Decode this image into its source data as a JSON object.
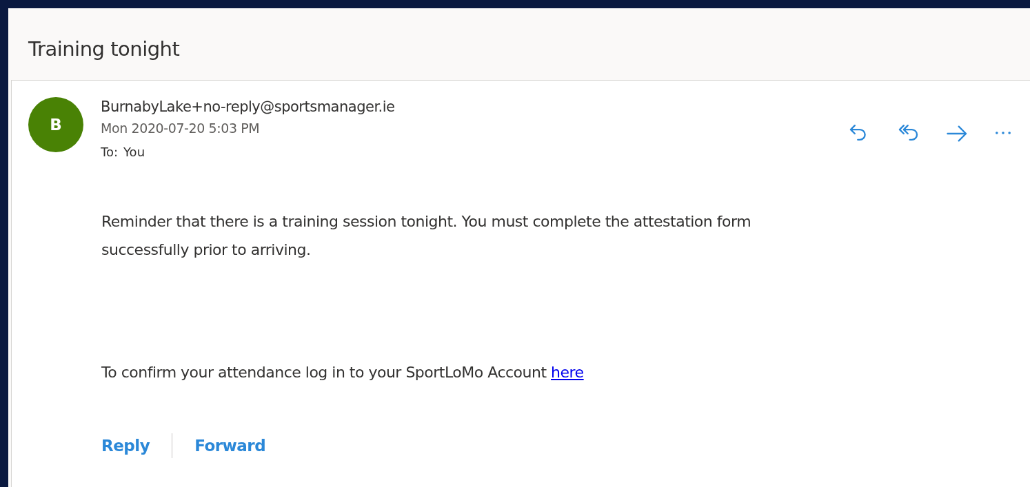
{
  "subject": "Training tonight",
  "message": {
    "avatar": {
      "initial": "B",
      "color": "#498205"
    },
    "sender": "BurnabyLake+no-reply@sportsmanager.ie",
    "date": "Mon 2020-07-20 5:03 PM",
    "to_label": "To:",
    "to": "You",
    "toolbar": [
      {
        "kind": "reply"
      },
      {
        "kind": "reply-all"
      },
      {
        "kind": "forward"
      },
      {
        "kind": "more"
      }
    ],
    "body": [
      {
        "text": "Reminder that there is a training session tonight. You must complete the attestation form successfully prior to arriving."
      },
      {
        "text": "To confirm your attendance log in to your SportLoMo Account",
        "link": "here"
      }
    ],
    "actions": [
      "Reply",
      "Forward"
    ]
  }
}
